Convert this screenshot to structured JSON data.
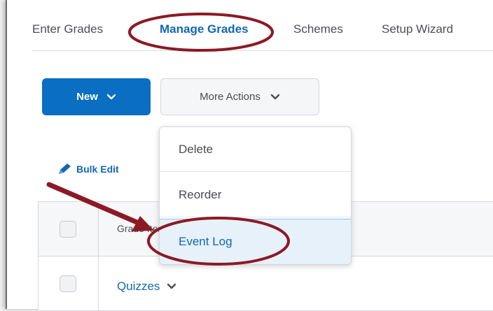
{
  "tabs": [
    {
      "label": "Enter Grades",
      "active": false
    },
    {
      "label": "Manage Grades",
      "active": true
    },
    {
      "label": "Schemes",
      "active": false
    },
    {
      "label": "Setup Wizard",
      "active": false
    }
  ],
  "toolbar": {
    "new_label": "New",
    "more_actions_label": "More Actions"
  },
  "bulk_edit": {
    "label": "Bulk Edit",
    "icon": "pencil-icon"
  },
  "table": {
    "header_label": "Grade Items",
    "rows": [
      {
        "label": "Quizzes"
      }
    ]
  },
  "menu": {
    "items": [
      {
        "label": "Delete"
      },
      {
        "label": "Reorder"
      },
      {
        "label": "Event Log",
        "highlighted": true
      }
    ]
  },
  "colors": {
    "primary": "#0a6ec2",
    "link": "#1467b3",
    "annotation": "#8b1a24"
  }
}
